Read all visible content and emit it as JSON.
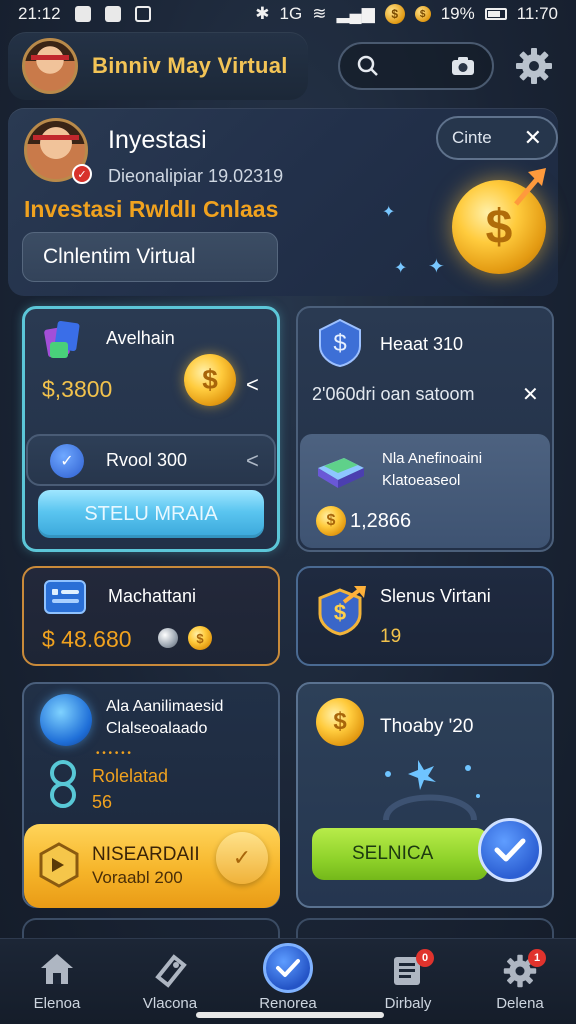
{
  "status_bar": {
    "time_left": "21:12",
    "network": "1G",
    "battery_percent": "19%",
    "time_right": "11:70"
  },
  "header": {
    "app_title": "Binniv May Virtual"
  },
  "hero": {
    "title": "Inyestasi",
    "subtitle": "Dieonalipiar 19.02319",
    "headline": "Investasi Rwldlı Cnlaas",
    "button_label": "Clnlentim Virtual",
    "chip_label": "Cinte",
    "chip_close": "✕"
  },
  "card_a": {
    "title": "Avelhain",
    "value": "$,3800",
    "arrow": "<",
    "row_label": "Rvool 300",
    "row_arrow": "<",
    "button_label": "STELU MRAIA"
  },
  "card_b": {
    "title": "Heaat 310",
    "subtitle": "2'060dri oan satoom",
    "close": "✕",
    "inner_line1": "Nla Anefinoaini",
    "inner_line2": "Klatoeaseol",
    "inner_value": "1,2866"
  },
  "card_c": {
    "title": "Machattani",
    "value": "$ 48.680"
  },
  "card_d": {
    "title": "Slenus Virtani",
    "value": "19"
  },
  "card_e": {
    "line1": "Ala Aanilimaesid",
    "line2": "Clalseoalaado",
    "small": "• • • • • •",
    "label": "Rolelatad",
    "value": "56",
    "button_title": "NISEARDAII",
    "button_sub": "Voraabl 200"
  },
  "card_f": {
    "title": "Thoaby '20",
    "button_label": "SELNICA"
  },
  "bottom_nav": {
    "items": [
      {
        "label": "Elenoa"
      },
      {
        "label": "Vlacona"
      },
      {
        "label": "Renorea"
      },
      {
        "label": "Dirbaly",
        "badge": "0"
      },
      {
        "label": "Delena",
        "badge": "1"
      }
    ]
  },
  "colors": {
    "accent_gold": "#f2c24c",
    "accent_orange": "#f0a21f",
    "accent_cyan": "#5cc6d8",
    "accent_green": "#8fd22a",
    "accent_blue": "#2c5fd3"
  }
}
